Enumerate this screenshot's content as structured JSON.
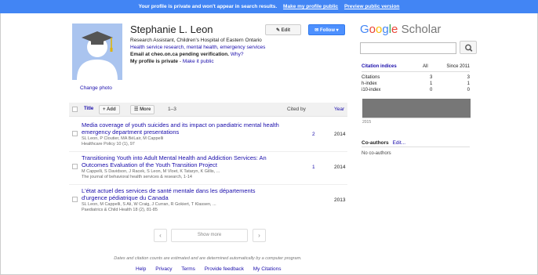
{
  "banner": {
    "message": "Your profile is private and won't appear in search results.",
    "make_public": "Make my profile public",
    "preview": "Preview public version"
  },
  "profile": {
    "name": "Stephanie L. Leon",
    "affiliation": "Research Assistant, Children's Hospital of Eastern Ontario",
    "interests": "Health service research, mental health, emergency services",
    "email_line": "Email at cheo.on.ca pending verification.",
    "why": "Why?",
    "private_line": "My profile is private",
    "make_public": "Make it public",
    "change_photo": "Change photo",
    "edit_label": "Edit",
    "follow_label": "Follow"
  },
  "table": {
    "title_col": "Title",
    "add_label": "Add",
    "more_label": "More",
    "range": "1–3",
    "cited_by_col": "Cited by",
    "year_col": "Year"
  },
  "articles": [
    {
      "title": "Media coverage of youth suicides and its impact on paediatric mental health emergency department presentations",
      "authors": "SL Leon, P Cloutier, MA BéLair, M Cappelli",
      "journal": "Healthcare Policy 10 (1), 97",
      "cited_by": "2",
      "year": "2014"
    },
    {
      "title": "Transitioning Youth into Adult Mental Health and Addiction Services: An Outcomes Evaluation of the Youth Transition Project",
      "authors": "M Cappelli, S Davidson, J Racek, S Leon, M Vloet, K Tataryn, K Gillis, ...",
      "journal": "The journal of behavioral health services & research, 1-14",
      "cited_by": "1",
      "year": "2014"
    },
    {
      "title": "L'état actuel des services de santé mentale dans les départements d'urgence pédiatrique du Canada",
      "authors": "SL Leon, M Cappelli, S Ali, W Craig, J Curran, R Gokiert, T Klassen, ...",
      "journal": "Paediatrics & Child Health 18 (2), 81-85",
      "cited_by": "",
      "year": "2013"
    }
  ],
  "pagination": {
    "prev": "‹",
    "show_more": "Show more",
    "next": "›"
  },
  "footer": {
    "note": "Dates and citation counts are estimated and are determined automatically by a computer program.",
    "links": [
      "Help",
      "Privacy",
      "Terms",
      "Provide feedback",
      "My Citations"
    ]
  },
  "sidebar": {
    "logo_google": "Google",
    "logo_scholar": "Scholar",
    "search_placeholder": "",
    "citation_indices": {
      "label": "Citation indices",
      "col_all": "All",
      "col_since": "Since 2011",
      "rows": [
        {
          "name": "Citations",
          "all": "3",
          "since": "3"
        },
        {
          "name": "h-index",
          "all": "1",
          "since": "1"
        },
        {
          "name": "i10-index",
          "all": "0",
          "since": "0"
        }
      ]
    },
    "chart_year": "2015",
    "coauthors_label": "Co-authors",
    "coauthors_edit": "Edit...",
    "no_coauthors": "No co-authors"
  },
  "chart_data": {
    "type": "bar",
    "categories": [
      "2015"
    ],
    "values": [
      3
    ]
  },
  "colors": {
    "banner": "#4285f4",
    "link": "#1a0dab",
    "follow_button": "#4d90fe",
    "google_blue": "#4285f4",
    "google_red": "#ea4335",
    "google_yellow": "#fbbc05",
    "google_green": "#34a853"
  }
}
